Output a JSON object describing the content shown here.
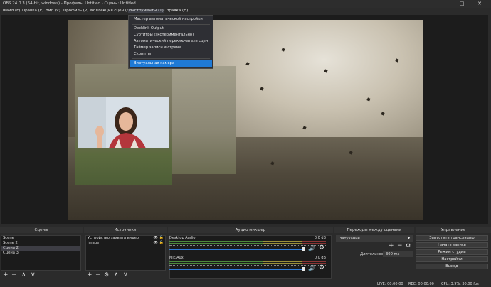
{
  "window": {
    "title": "OBS 24.0.3 (64-bit, windows) - Профиль: Untitled - Сцены: Untitled",
    "minimize": "–",
    "maximize": "□",
    "close": "✕"
  },
  "menubar": {
    "items": [
      "Файл (F)",
      "Правка (E)",
      "Вид (V)",
      "Профиль (P)",
      "Коллекция сцен (S)",
      "Инструменты (T)",
      "Справка (H)"
    ]
  },
  "tools_menu": {
    "items": [
      "Мастер автоматической настройки",
      "Decklink Output",
      "Субтитры (экспериментально)",
      "Автоматический переключатель сцен",
      "Таймер записи и стрима",
      "Скрипты",
      "Виртуальная камера"
    ],
    "selected": "Виртуальная камера"
  },
  "scenes": {
    "title": "Сцены",
    "items": [
      "Scene",
      "Scene 2",
      "Сцена 2",
      "Сцена 3"
    ],
    "selected": "Сцена 2"
  },
  "sources": {
    "title": "Источники",
    "items": [
      "Устройство захвата видео",
      "Image"
    ]
  },
  "mixer": {
    "title": "Аудио микшер",
    "channels": [
      {
        "name": "Desktop Audio",
        "db": "0.0 dB",
        "level": 1.0
      },
      {
        "name": "Mic/Aux",
        "db": "0.0 dB",
        "level": 1.0
      }
    ]
  },
  "transitions": {
    "title": "Переходы между сценами",
    "selected": "Затухание",
    "duration_label": "Длительность",
    "duration_value": "300 ms"
  },
  "controls": {
    "title": "Управление",
    "buttons": [
      "Запустить трансляцию",
      "Начать запись",
      "Режим студии",
      "Настройки",
      "Выход"
    ]
  },
  "status": {
    "live": "LIVE: 00:00:00",
    "rec": "REC: 00:00:00",
    "cpu": "CPU: 3.9%, 30.00 fps"
  },
  "toolbar_glyphs": {
    "add": "+",
    "remove": "−",
    "settings": "⚙",
    "up": "∧",
    "down": "∨"
  },
  "colors": {
    "accent": "#1f7ad6",
    "background": "#2b2b2b",
    "panel": "#1b1b1b"
  }
}
